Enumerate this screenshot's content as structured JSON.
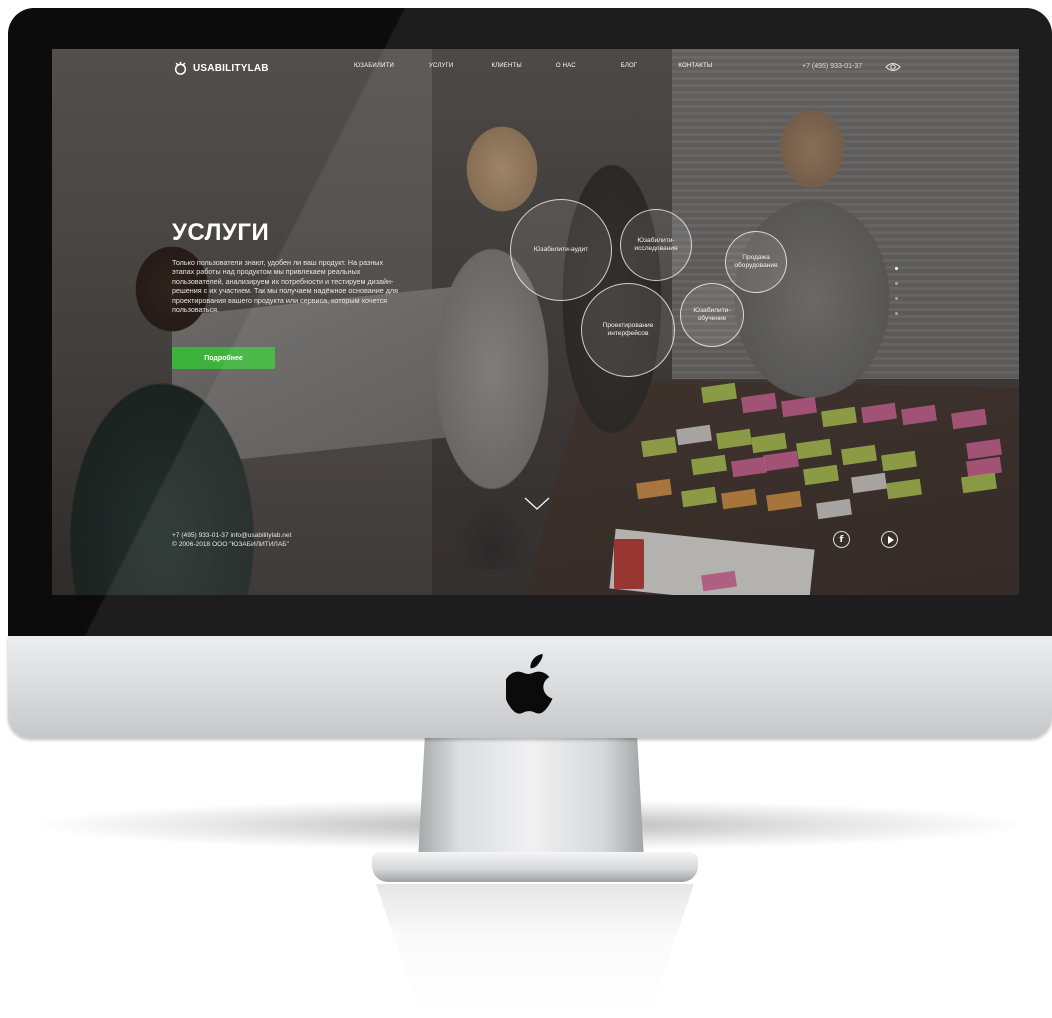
{
  "header": {
    "logo_text": "USABILITYLAB",
    "nav": [
      "ЮЗАБИЛИТИ",
      "УСЛУГИ",
      "КЛИЕНТЫ",
      "О НАС",
      "БЛОГ",
      "КОНТАКТЫ"
    ],
    "phone": "+7 (495) 933-01-37"
  },
  "hero": {
    "title": "УСЛУГИ",
    "text": "Только пользователи знают, удобен ли ваш продукт. На разных этапах работы над продуктом мы привлекаем реальных пользователей, анализируем их потребности и тестируем дизайн-решения с их участием. Так мы получаем надёжное основание для проектирования вашего продукта или сервиса, которым хочется пользоваться.",
    "button_label": "Подробнее"
  },
  "services": [
    "Юзабилити-аудит",
    "Юзабилити-исследования",
    "Продажа оборудования",
    "Юзабилити-обучение",
    "Проектирование интерфейсов"
  ],
  "slider": {
    "count": 4,
    "active_index": 0
  },
  "footer": {
    "contact_line": "+7 (495) 933-01-37 info@usabilitylab.net",
    "copyright": "© 2006-2018 ООО \"ЮЗАБИЛИТИЛАБ\""
  },
  "colors": {
    "accent": "#3cb43c",
    "bezel": "#0c0c0c"
  },
  "icons": [
    "usabilitylab-logo-icon",
    "eye-icon",
    "chevron-down-icon",
    "facebook-icon",
    "play-icon",
    "apple-logo-icon"
  ]
}
